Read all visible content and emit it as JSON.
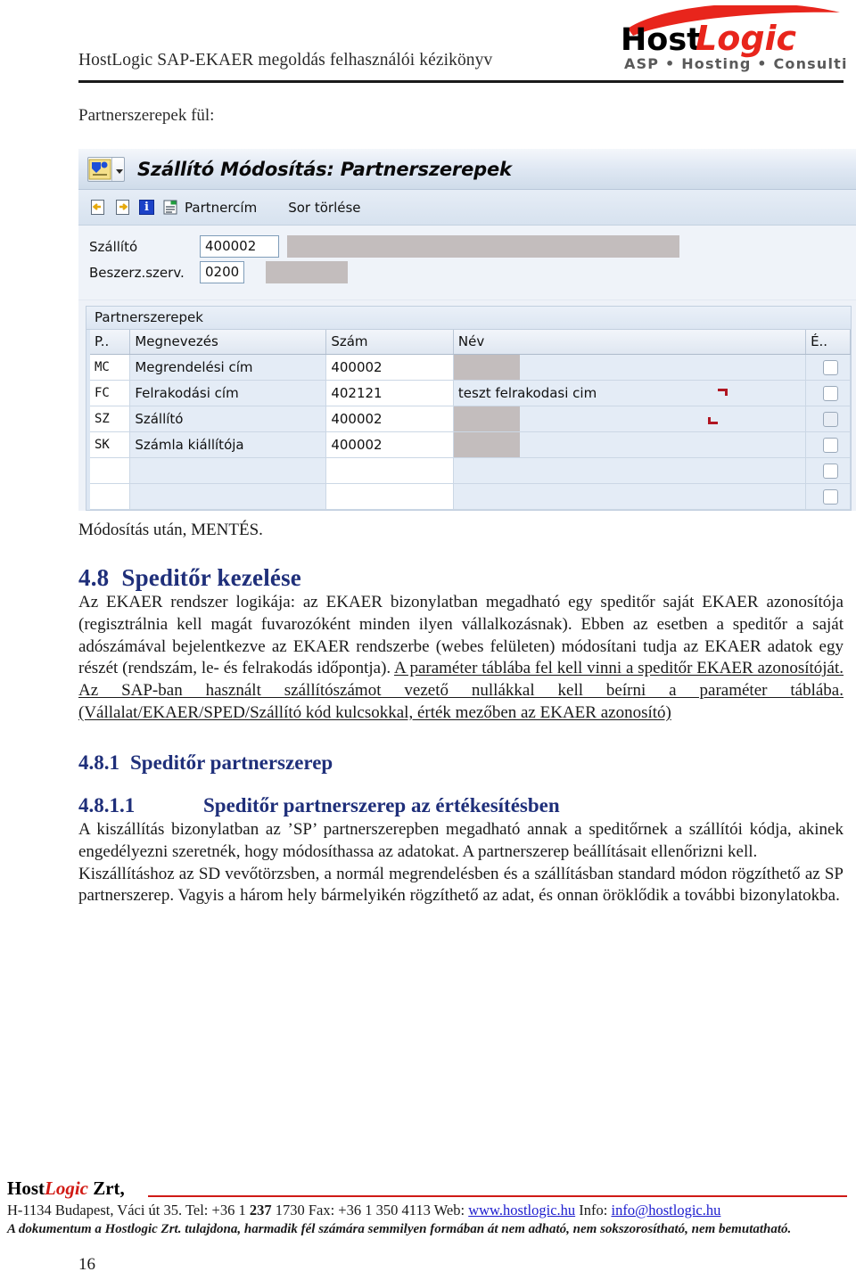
{
  "header": {
    "doc_title": "HostLogic SAP-EKAER megoldás felhasználói kézikönyv",
    "logo": {
      "brand_part1": "Host",
      "brand_part2": "Logic",
      "tagline": "ASP  •  Hosting  •  Consulting",
      "accent_color": "#e8251c",
      "dark_color": "#000000",
      "tagline_color": "#5a5a5a"
    }
  },
  "content": {
    "lead_line": "Partnerszerepek fül:",
    "after_screenshot_line": "Módosítás után, MENTÉS."
  },
  "sap_screenshot": {
    "window_title": "Szállító Módosítás: Partnerszerepek",
    "toolbar": {
      "back_icon": "back-arrow-document-icon",
      "forward_icon": "forward-arrow-document-icon",
      "info_icon": "info-icon",
      "info_glyph": "i",
      "partner_address_label": "Partnercím",
      "delete_row_label": "Sor törlése"
    },
    "fields": [
      {
        "label": "Szállító",
        "value": "400002"
      },
      {
        "label": "Beszerz.szerv.",
        "value": "0200"
      }
    ],
    "panel_title": "Partnerszerepek",
    "grid": {
      "columns": [
        "P..",
        "Megnevezés",
        "Szám",
        "Név",
        "É.."
      ],
      "rows": [
        {
          "key": "MC",
          "desc": "Megrendelési cím",
          "num": "400002",
          "name": "",
          "checked": false,
          "masked": true,
          "selected": false
        },
        {
          "key": "FC",
          "desc": "Felrakodási cím",
          "num": "402121",
          "name": "teszt felrakodasi cim",
          "checked": false,
          "masked": false,
          "selected": true
        },
        {
          "key": "SZ",
          "desc": "Szállító",
          "num": "400002",
          "name": "",
          "checked": false,
          "masked": true,
          "selected": false
        },
        {
          "key": "SK",
          "desc": "Számla kiállítója",
          "num": "400002",
          "name": "",
          "checked": false,
          "masked": true,
          "selected": false
        },
        {
          "key": "",
          "desc": "",
          "num": "",
          "name": "",
          "checked": false,
          "masked": false,
          "selected": false
        },
        {
          "key": "",
          "desc": "",
          "num": "",
          "name": "",
          "checked": false,
          "masked": false,
          "selected": false
        }
      ]
    }
  },
  "sections": {
    "s48": {
      "number": "4.8",
      "title": "Speditőr kezelése",
      "paragraph_1": "Az EKAER rendszer logikája: az EKAER bizonylatban megadható egy speditőr saját EKAER azonosítója (regisztrálnia kell magát fuvarozóként minden ilyen vállalkozásnak). Ebben az esetben a speditőr a saját adószámával bejelentkezve az EKAER rendszerbe (webes felületen) módosítani tudja az EKAER adatok egy részét (rendszám, le- és felrakodás időpontja). ",
      "paragraph_1_underlined": "A paraméter táblába fel kell vinni a speditőr EKAER azonosítóját. Az SAP-ban használt szállítószámot vezető nullákkal kell beírni a paraméter táblába. (Vállalat/EKAER/SPED/Szállító kód kulcsokkal, érték mezőben az EKAER azonosító)"
    },
    "s481": {
      "number": "4.8.1",
      "title": "Speditőr partnerszerep"
    },
    "s4811": {
      "number": "4.8.1.1",
      "title": "Speditőr partnerszerep az értékesítésben",
      "paragraph_1": "A kiszállítás bizonylatban az ’SP’ partnerszerepben megadható annak a speditőrnek a szállítói kódja, akinek engedélyezni szeretnék, hogy módosíthassa az adatokat. A partnerszerep beállításait ellenőrizni kell.",
      "paragraph_2": "Kiszállításhoz az SD vevőtörzsben, a normál megrendelésben és a szállításban standard módon rögzíthető az SP partnerszerep. Vagyis a három hely bármelyikén rögzíthető az adat, és onnan öröklődik a további bizonylatokba."
    }
  },
  "footer": {
    "brand_prefix": "Host",
    "brand_italic": "Logic",
    "brand_suffix": " Zrt,",
    "contact_pre": "H-1134 Budapest, Váci út 35. Tel: +36 1 ",
    "contact_bold": "237",
    "contact_mid": " 1730 Fax: +36 1 350 4113 Web: ",
    "web_link": "www.hostlogic.hu",
    "contact_info_label": " Info: ",
    "email_link": "info@hostlogic.hu",
    "disclaimer": "A dokumentum a Hostlogic Zrt. tulajdona, harmadik fél számára semmilyen formában át nem adható, nem sokszorosítható, nem bemutatható.",
    "page_number": "16",
    "rule_color": "#cf1a16"
  }
}
